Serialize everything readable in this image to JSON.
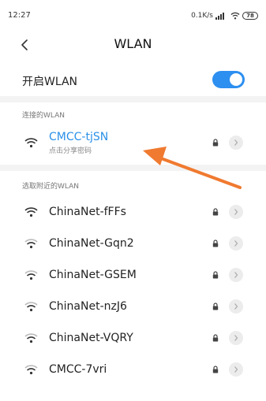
{
  "status_bar": {
    "time": "12:27",
    "network_speed": "0.1K/s",
    "battery": "78"
  },
  "header": {
    "title": "WLAN"
  },
  "wlan_toggle": {
    "label": "开启WLAN",
    "enabled": true
  },
  "connected_section": {
    "header": "连接的WLAN",
    "network": {
      "name": "CMCC-tjSN",
      "subtitle": "点击分享密码",
      "signal_icon": "wifi-icon"
    }
  },
  "nearby_section": {
    "header": "选取附近的WLAN",
    "networks": [
      {
        "name": "ChinaNet-fFFs"
      },
      {
        "name": "ChinaNet-Gqn2"
      },
      {
        "name": "ChinaNet-GSEM"
      },
      {
        "name": "ChinaNet-nzJ6"
      },
      {
        "name": "ChinaNet-VQRY"
      },
      {
        "name": "CMCC-7vri"
      }
    ]
  },
  "colors": {
    "accent": "#2d8ff0",
    "connected_text": "#2a90e8",
    "annotation_arrow": "#f07a30"
  }
}
